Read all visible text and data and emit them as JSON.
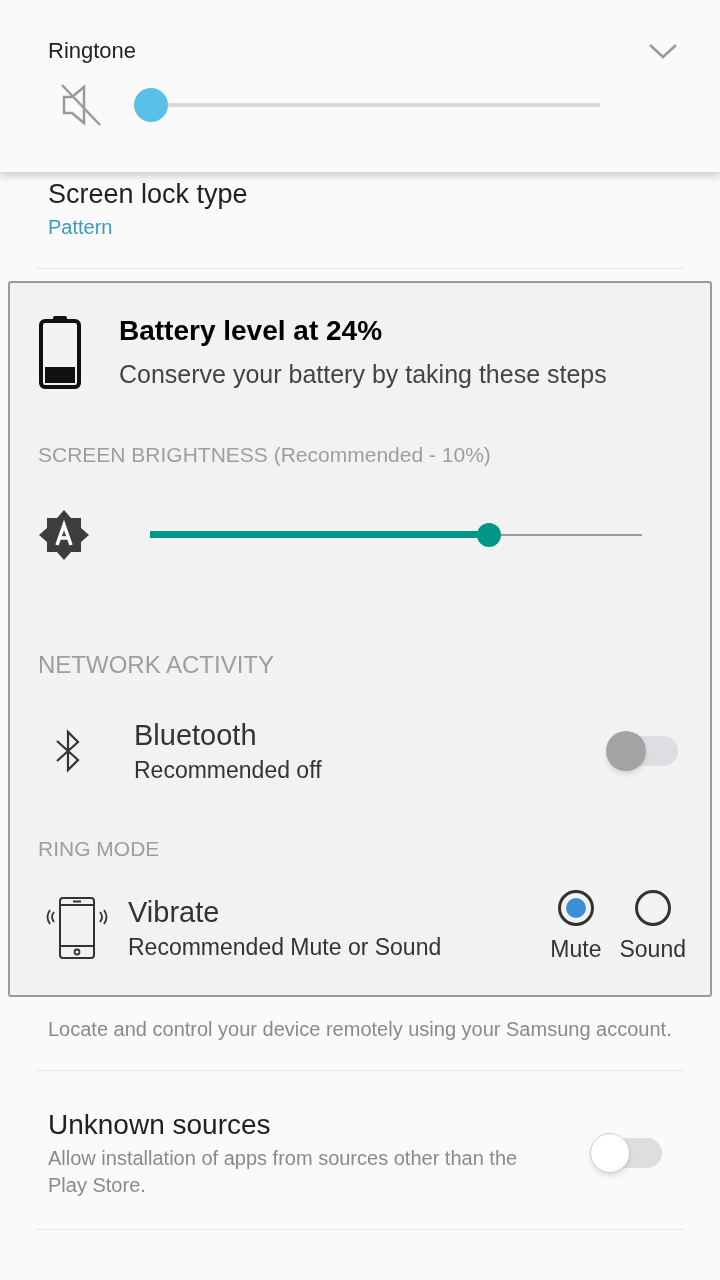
{
  "volume_panel": {
    "title": "Ringtone",
    "muted": true,
    "level": 0
  },
  "screen_lock": {
    "title": "Screen lock type",
    "value": "Pattern"
  },
  "battery_dialog": {
    "title": "Battery level at 24%",
    "subtitle": "Conserve your battery by taking these steps",
    "brightness": {
      "heading": "SCREEN BRIGHTNESS (Recommended - 10%)",
      "level": 0.69
    },
    "network": {
      "heading": "NETWORK ACTIVITY",
      "title": "Bluetooth",
      "subtitle": "Recommended off",
      "on": false
    },
    "ring_mode": {
      "heading": "RING MODE",
      "title": "Vibrate",
      "subtitle": "Recommended Mute or Sound",
      "options": [
        {
          "label": "Mute",
          "selected": true
        },
        {
          "label": "Sound",
          "selected": false
        }
      ]
    }
  },
  "find_my_mobile": {
    "description": "Locate and control your device remotely using your Samsung account."
  },
  "unknown_sources": {
    "title": "Unknown sources",
    "description": "Allow installation of apps from sources other than the Play Store.",
    "on": false
  }
}
